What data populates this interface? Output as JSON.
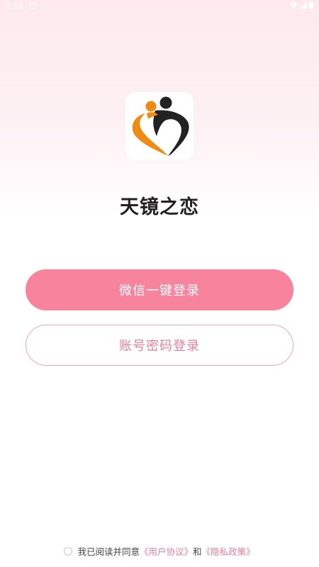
{
  "status_bar": {
    "time": "1:10",
    "icons": [
      "wifi-icon",
      "signal-icon",
      "battery-icon"
    ]
  },
  "app": {
    "name": "天镜之恋",
    "logo_icon": "heart-couple-logo-icon"
  },
  "buttons": {
    "wechat_login": "微信一键登录",
    "account_login": "账号密码登录"
  },
  "agreement": {
    "prefix": "我已阅读并同意",
    "user_agreement": "《用户协议》",
    "conjunction": "和",
    "privacy_policy": "《隐私政策》",
    "checked": false
  },
  "colors": {
    "primary": "#f7839d",
    "link": "#f07e98",
    "logo_orange": "#f08a12",
    "logo_dark": "#222222"
  }
}
